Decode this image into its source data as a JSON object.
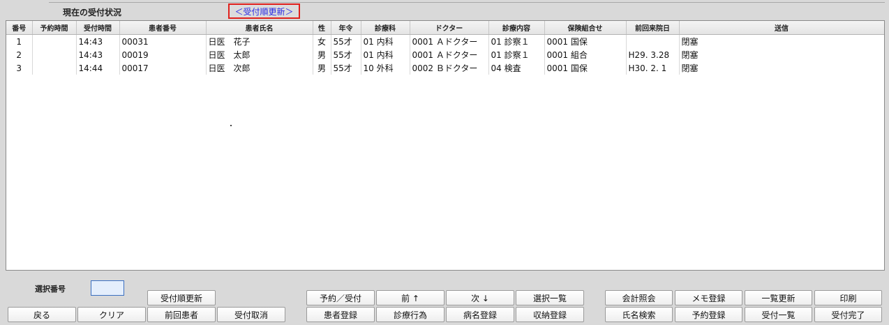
{
  "page": {
    "title": "現在の受付状況",
    "reorder_link": "＜受付順更新＞"
  },
  "table": {
    "headers": [
      "番号",
      "予約時間",
      "受付時間",
      "患者番号",
      "患者氏名",
      "性",
      "年令",
      "診療科",
      "ドクター",
      "診療内容",
      "保険組合せ",
      "前回来院日",
      "送信"
    ],
    "rows": [
      [
        "1",
        "",
        "14:43",
        "00031",
        "日医　花子",
        "女",
        "55才",
        "01 内科",
        "0001 Ａドクター",
        "01 診察１",
        "0001 国保",
        "",
        "閉塞"
      ],
      [
        "2",
        "",
        "14:43",
        "00019",
        "日医　太郎",
        "男",
        "55才",
        "01 内科",
        "0001 Ａドクター",
        "01 診察１",
        "0001 組合",
        "H29. 3.28",
        "閉塞"
      ],
      [
        "3",
        "",
        "14:44",
        "00017",
        "日医　次郎",
        "男",
        "55才",
        "10 外科",
        "0002 Ｂドクター",
        "04 検査",
        "0001 国保",
        "H30. 2. 1",
        "閉塞"
      ]
    ]
  },
  "selection": {
    "label": "選択番号",
    "value": ""
  },
  "buttons": {
    "reorder": "受付順更新",
    "back": "戻る",
    "clear": "クリア",
    "previous_patient": "前回患者",
    "cancel_reception": "受付取消",
    "reservation_reception": "予約／受付",
    "prev": "前 ↑",
    "next": "次 ↓",
    "selection_list": "選択一覧",
    "patient_registration": "患者登録",
    "treatment_act": "診療行為",
    "disease_registration": "病名登録",
    "payment_registration": "収納登録",
    "account_inquiry": "会計照会",
    "memo_registration": "メモ登録",
    "list_update": "一覧更新",
    "print": "印刷",
    "name_search": "氏名検索",
    "reservation_registration": "予約登録",
    "reception_list": "受付一覧",
    "reception_complete": "受付完了"
  }
}
